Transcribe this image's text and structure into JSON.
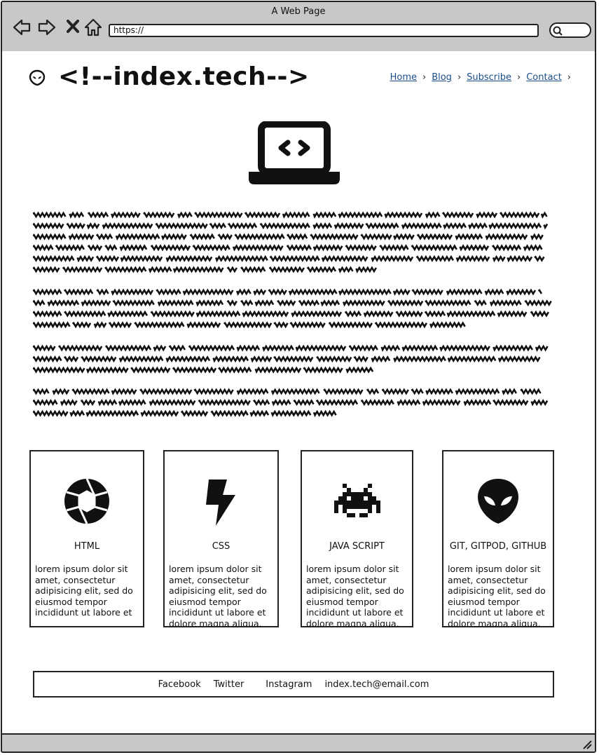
{
  "window": {
    "title": "A Web Page"
  },
  "browser": {
    "url": "https://"
  },
  "site": {
    "title": "<!--index.tech-->"
  },
  "nav": {
    "items": [
      "Home",
      "Blog",
      "Subscribe",
      "Contact"
    ]
  },
  "cards": [
    {
      "title": "HTML",
      "icon": "aperture-icon",
      "text": "lorem ipsum dolor sit amet, consectetur adipisicing elit, sed do eiusmod tempor incididunt ut labore et"
    },
    {
      "title": "CSS",
      "icon": "lightning-icon",
      "text": "lorem ipsum dolor sit amet, consectetur adipisicing elit, sed do eiusmod tempor incididunt ut labore et dolore magna aliqua. Ut"
    },
    {
      "title": "JAVA SCRIPT",
      "icon": "space-invader-icon",
      "text": "lorem ipsum dolor sit amet, consectetur adipisicing elit, sed do eiusmod tempor incididunt ut labore et dolore magna aliqua. Ut"
    },
    {
      "title": "GIT, GITPOD, GITHUB",
      "icon": "alien-icon",
      "text": "lorem ipsum dolor sit amet, consectetur adipisicing elit, sed do eiusmod tempor incididunt ut labore et dolore magna aliqua. Ut"
    }
  ],
  "footer": {
    "links": [
      "Facebook",
      "Twitter",
      "Instagram",
      "index.tech@email.com"
    ]
  },
  "icons": {
    "logo": "alien-icon",
    "hero": "laptop-code-icon"
  }
}
